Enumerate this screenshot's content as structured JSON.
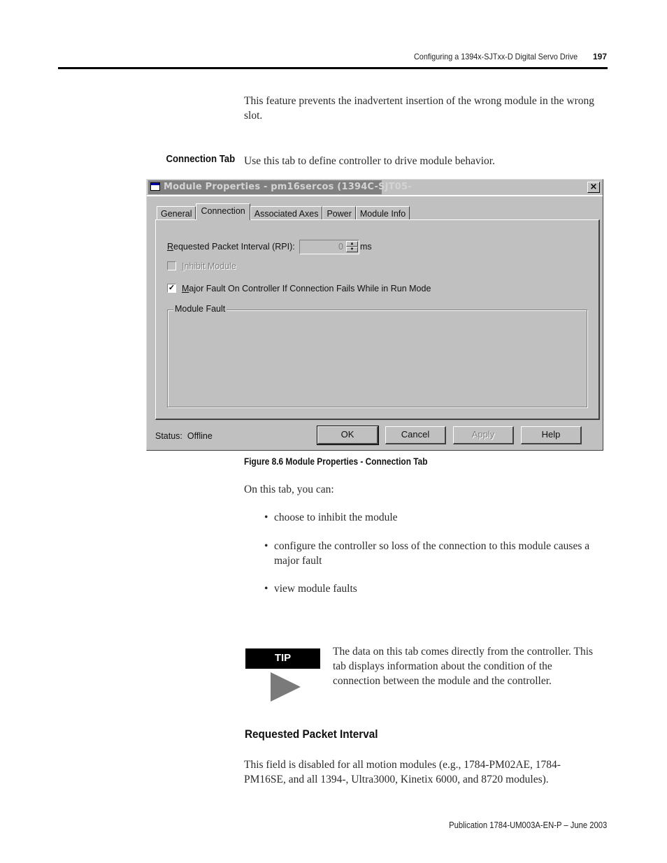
{
  "page_header": {
    "chapter_title": "Configuring a 1394x-SJTxx-D Digital Servo Drive",
    "page_number": "197"
  },
  "intro_paragraph": "This feature prevents the inadvertent insertion of the wrong module in the wrong slot.",
  "section": {
    "side_heading": "Connection Tab",
    "lead_text": "Use this tab to define controller to drive module behavior."
  },
  "dialog": {
    "title": "Module Properties - pm16sercos (1394C-SJT05-",
    "close_glyph": "×",
    "tabs": [
      {
        "label": "General",
        "active": false
      },
      {
        "label": "Connection",
        "active": true
      },
      {
        "label": "Associated Axes",
        "active": false
      },
      {
        "label": "Power",
        "active": false
      },
      {
        "label": "Module Info",
        "active": false
      }
    ],
    "rpi": {
      "label_mnemonic": "R",
      "label_rest": "equested Packet Interval (RPI):",
      "value": "0",
      "unit": "ms"
    },
    "inhibit_module": {
      "label_mnemonic": "I",
      "label_rest": "nhibit Module",
      "checked": false,
      "enabled": false
    },
    "major_fault": {
      "label_mnemonic": "M",
      "label_rest": "ajor Fault On Controller If Connection Fails While in Run Mode",
      "checked": true,
      "check_glyph": "✓"
    },
    "module_fault_group": {
      "label": "Module Fault",
      "content": ""
    },
    "status_label": "Status:",
    "status_value": "Offline",
    "buttons": {
      "ok": "OK",
      "cancel": "Cancel",
      "apply": "Apply",
      "help": "Help"
    }
  },
  "figure_caption": "Figure 8.6 Module Properties - Connection Tab",
  "list_intro": "On this tab, you can:",
  "bullets": [
    "choose to inhibit the module",
    "configure the controller so loss of the connection to this module causes a major fault",
    "view module faults"
  ],
  "tip": {
    "label": "TIP",
    "text": "The data on this tab comes directly from the controller. This tab displays information about the condition of the connection between the module and the controller."
  },
  "subsection": {
    "heading": "Requested Packet Interval",
    "text": "This field is disabled for all motion modules (e.g., 1784-PM02AE, 1784-PM16SE, and all 1394-, Ultra3000, Kinetix 6000, and 8720 modules)."
  },
  "footer": "Publication 1784-UM003A-EN-P – June 2003"
}
